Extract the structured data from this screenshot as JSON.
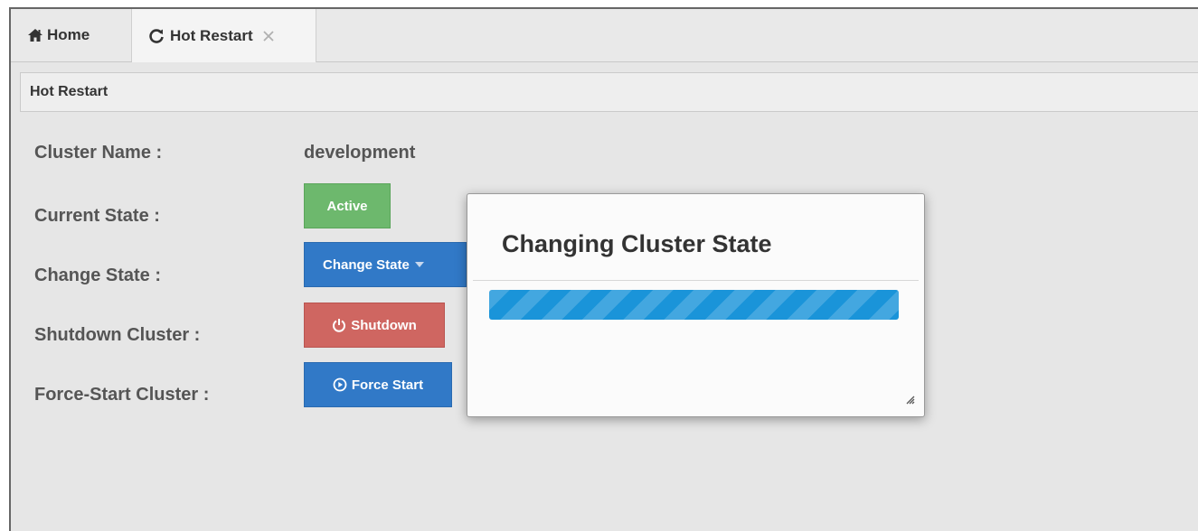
{
  "tabs": [
    {
      "label": "Home",
      "icon": "home-icon"
    },
    {
      "label": "Hot Restart",
      "icon": "refresh-icon",
      "closable": true
    }
  ],
  "breadcrumb": "Hot Restart",
  "fields": {
    "cluster_name_label": "Cluster Name :",
    "cluster_name_value": "development",
    "current_state_label": "Current State :",
    "current_state_value": "Active",
    "change_state_label": "Change State :",
    "change_state_button": "Change State",
    "shutdown_label": "Shutdown Cluster :",
    "shutdown_button": "Shutdown",
    "force_start_label": "Force-Start Cluster :",
    "force_start_button": "Force Start"
  },
  "modal": {
    "title": "Changing Cluster State",
    "progress": 1.0
  },
  "colors": {
    "active": "#6db86d",
    "primary": "#3179c7",
    "danger": "#cf6661",
    "progress": "#1a94d9"
  }
}
